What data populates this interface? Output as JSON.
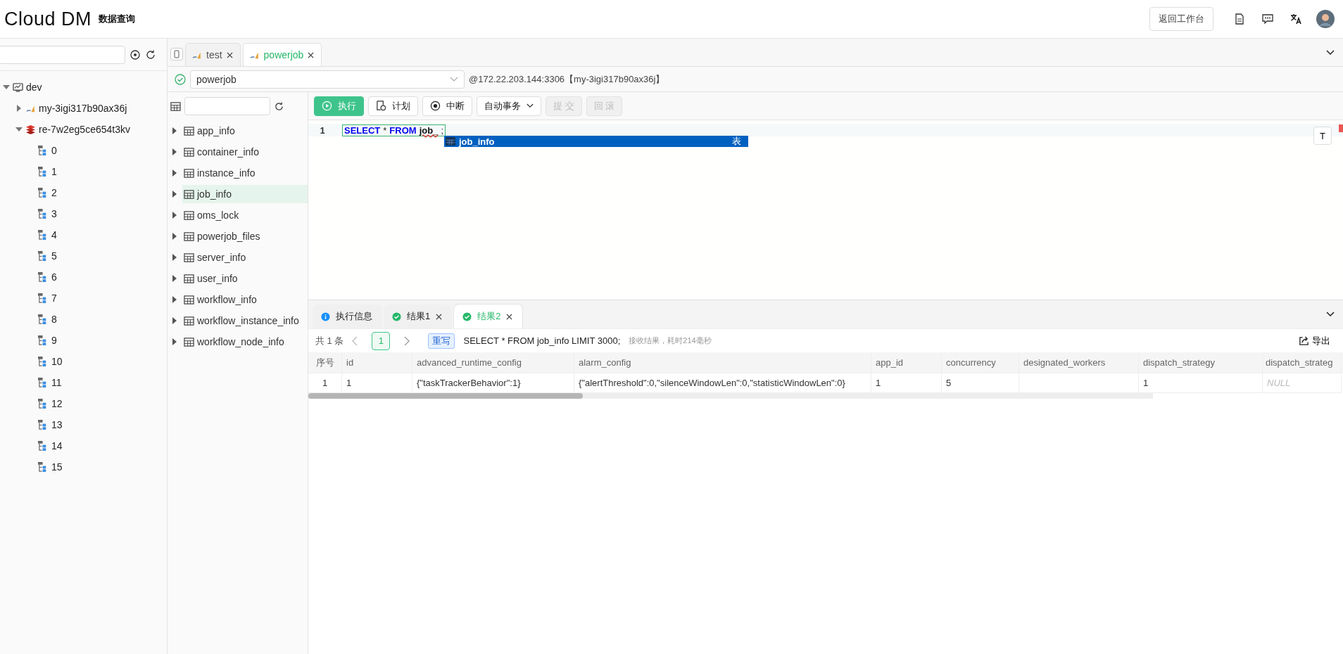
{
  "header": {
    "logo": "Cloud DM",
    "subtitle": "数据查询",
    "back_button": "返回工作台"
  },
  "sidebar": {
    "tree": [
      {
        "label": "dev",
        "kind": "env",
        "expanded": true,
        "children": [
          {
            "label": "my-3igi317b90ax36j",
            "kind": "mysql",
            "expanded": false
          },
          {
            "label": "re-7w2eg5ce654t3kv",
            "kind": "redis",
            "expanded": true,
            "children": [
              {
                "label": "0",
                "kind": "db"
              },
              {
                "label": "1",
                "kind": "db"
              },
              {
                "label": "2",
                "kind": "db"
              },
              {
                "label": "3",
                "kind": "db"
              },
              {
                "label": "4",
                "kind": "db"
              },
              {
                "label": "5",
                "kind": "db"
              },
              {
                "label": "6",
                "kind": "db"
              },
              {
                "label": "7",
                "kind": "db"
              },
              {
                "label": "8",
                "kind": "db"
              },
              {
                "label": "9",
                "kind": "db"
              },
              {
                "label": "10",
                "kind": "db"
              },
              {
                "label": "11",
                "kind": "db"
              },
              {
                "label": "12",
                "kind": "db"
              },
              {
                "label": "13",
                "kind": "db"
              },
              {
                "label": "14",
                "kind": "db"
              },
              {
                "label": "15",
                "kind": "db"
              }
            ]
          }
        ]
      }
    ]
  },
  "editor_tabs": [
    {
      "label": "test",
      "selected": false
    },
    {
      "label": "powerjob",
      "selected": true
    }
  ],
  "connection": {
    "database": "powerjob",
    "address": "@172.22.203.144:3306【my-3igi317b90ax36j】"
  },
  "tables": [
    {
      "label": "app_info",
      "selected": false
    },
    {
      "label": "container_info",
      "selected": false
    },
    {
      "label": "instance_info",
      "selected": false
    },
    {
      "label": "job_info",
      "selected": true
    },
    {
      "label": "oms_lock",
      "selected": false
    },
    {
      "label": "powerjob_files",
      "selected": false
    },
    {
      "label": "server_info",
      "selected": false
    },
    {
      "label": "user_info",
      "selected": false
    },
    {
      "label": "workflow_info",
      "selected": false
    },
    {
      "label": "workflow_instance_info",
      "selected": false
    },
    {
      "label": "workflow_node_info",
      "selected": false
    }
  ],
  "toolbar": [
    {
      "label": "执行",
      "kind": "run",
      "disabled": false
    },
    {
      "label": "计划",
      "kind": "plan",
      "disabled": false
    },
    {
      "label": "中断",
      "kind": "stop",
      "disabled": false
    },
    {
      "label": "自动事务",
      "kind": "dropdown",
      "disabled": false
    },
    {
      "label": "提 交",
      "kind": "plain",
      "disabled": true
    },
    {
      "label": "回 滚",
      "kind": "plain",
      "disabled": true
    }
  ],
  "editor": {
    "line_number": "1",
    "tokens": [
      {
        "kind": "keyword",
        "text": "SELECT"
      },
      {
        "kind": "plain",
        "text": "*"
      },
      {
        "kind": "keyword",
        "text": "FROM"
      },
      {
        "kind": "ident",
        "text": "job_"
      },
      {
        "kind": "plain",
        "text": ";"
      }
    ],
    "suggestion": {
      "label": "job_info",
      "type": "表"
    },
    "format_button": "T"
  },
  "result_tabs": [
    {
      "label": "执行信息",
      "kind": "info",
      "selected": false
    },
    {
      "label": "结果1",
      "kind": "result",
      "selected": false
    },
    {
      "label": "结果2",
      "kind": "result",
      "selected": true
    }
  ],
  "result_info": {
    "total": "共 1 条",
    "pages": [
      {
        "label": "1",
        "selected": true
      }
    ],
    "tag": "重写",
    "sql": "SELECT * FROM job_info LIMIT 3000;",
    "timing": "接收结果，耗时214毫秒",
    "export": "导出"
  },
  "table": {
    "columns": [
      "序号",
      "id",
      "advanced_runtime_config",
      "alarm_config",
      "app_id",
      "concurrency",
      "designated_workers",
      "dispatch_strategy",
      "dispatch_strateg"
    ],
    "rows": [
      {
        "cells": [
          {
            "kind": "index",
            "text": "1"
          },
          {
            "kind": "value",
            "text": "1"
          },
          {
            "kind": "value",
            "text": "{\"taskTrackerBehavior\":1}"
          },
          {
            "kind": "value",
            "text": "{\"alertThreshold\":0,\"silenceWindowLen\":0,\"statisticWindowLen\":0}"
          },
          {
            "kind": "value",
            "text": "1"
          },
          {
            "kind": "value",
            "text": "5"
          },
          {
            "kind": "empty"
          },
          {
            "kind": "value",
            "text": "1"
          },
          {
            "kind": "null",
            "text": "NULL"
          }
        ]
      }
    ]
  }
}
